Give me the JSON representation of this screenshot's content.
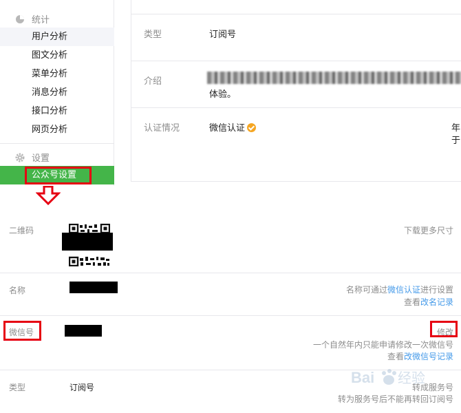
{
  "sidebar": {
    "stats_heading": "统计",
    "stats_items": [
      {
        "label": "用户分析"
      },
      {
        "label": "图文分析"
      },
      {
        "label": "菜单分析"
      },
      {
        "label": "消息分析"
      },
      {
        "label": "接口分析"
      },
      {
        "label": "网页分析"
      }
    ],
    "settings_heading": "设置",
    "settings_items": [
      {
        "label": "公众号设置",
        "active": true
      }
    ]
  },
  "top_panel": {
    "rows": [
      {
        "label": "类型",
        "value": "订阅号"
      },
      {
        "label": "介绍",
        "value": "体验。"
      },
      {
        "label": "认证情况",
        "value": "微信认证",
        "right_cut": [
          "年",
          "于"
        ]
      }
    ]
  },
  "account_settings": {
    "qrcode": {
      "label": "二维码",
      "action": "下载更多尺寸"
    },
    "name": {
      "label": "名称",
      "note_prefix": "名称可通过",
      "note_link": "微信认证",
      "note_suffix": "进行设置",
      "record_prefix": "查看",
      "record_link": "改名记录"
    },
    "wechat_id": {
      "label": "微信号",
      "action": "修改",
      "note": "一个自然年内只能申请修改一次微信号",
      "record_prefix": "查看",
      "record_link": "改微信号记录"
    },
    "type": {
      "label": "类型",
      "value": "订阅号",
      "action": "转成服务号",
      "note": "转为服务号后不能再转回订阅号"
    }
  },
  "colors": {
    "accent_green": "#44b549",
    "highlight_red": "#e60012",
    "link_blue": "#459ae9",
    "verify_orange": "#f5a623"
  },
  "watermark": "Baidu经验"
}
